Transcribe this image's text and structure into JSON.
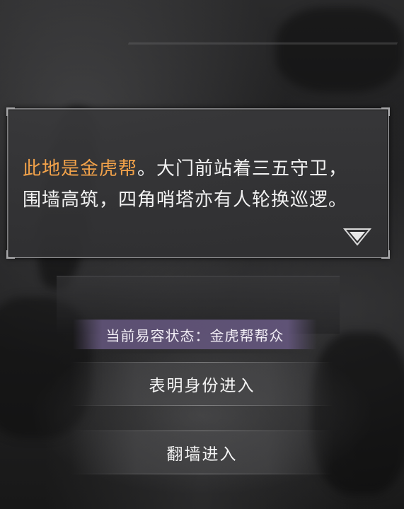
{
  "dialog": {
    "place_name": "此地是金虎帮",
    "line1_rest": "。大门前站着三五守卫，",
    "line2": "围墙高筑，四角哨塔亦有人轮换巡逻。",
    "place_color": "#f2a24a"
  },
  "status": {
    "text": "当前易容状态：金虎帮帮众",
    "background_color": "#62557a"
  },
  "choices": [
    {
      "label": "表明身份进入"
    },
    {
      "label": "翻墙进入"
    }
  ],
  "icons": {
    "continue": "triangle-down-icon"
  }
}
